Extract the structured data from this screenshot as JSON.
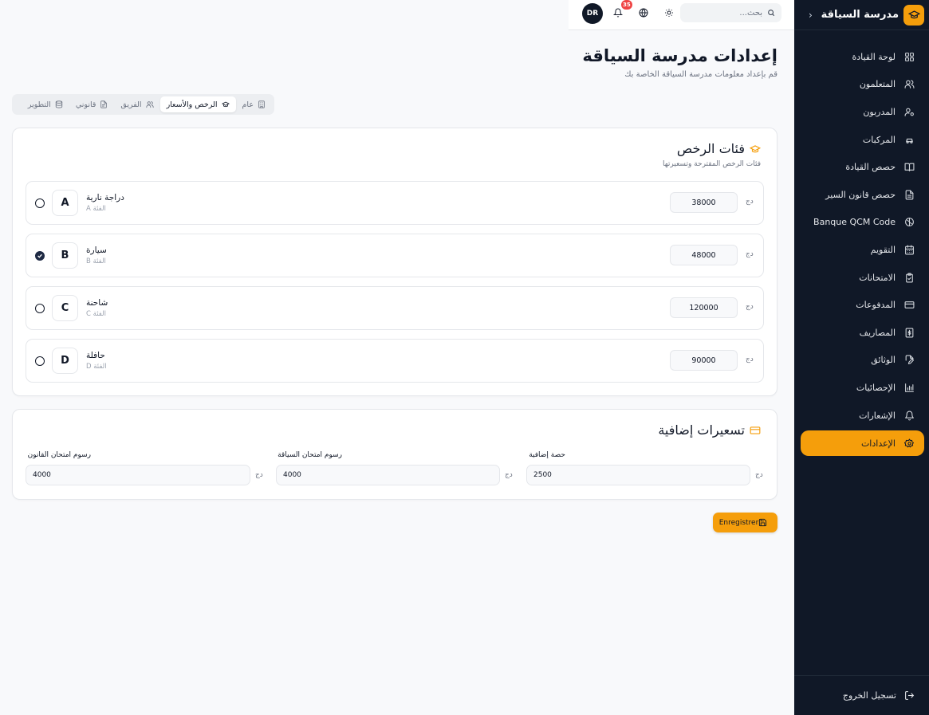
{
  "sidebar": {
    "brand": "مدرسة السياقة",
    "collapse_glyph": "‹",
    "items": [
      {
        "label": "لوحة القيادة",
        "icon": "grid-icon"
      },
      {
        "label": "المتعلمون",
        "icon": "users-icon"
      },
      {
        "label": "المدربون",
        "icon": "user-cog-icon"
      },
      {
        "label": "المركبات",
        "icon": "car-icon"
      },
      {
        "label": "حصص القيادة",
        "icon": "book-open-icon"
      },
      {
        "label": "حصص قانون السير",
        "icon": "file-text-icon"
      },
      {
        "label": "Banque QCM Code",
        "icon": "brain-icon"
      },
      {
        "label": "التقويم",
        "icon": "calendar-icon"
      },
      {
        "label": "الامتحانات",
        "icon": "clipboard-check-icon"
      },
      {
        "label": "المدفوعات",
        "icon": "credit-card-icon"
      },
      {
        "label": "المصاريف",
        "icon": "receipt-icon"
      },
      {
        "label": "الوثائق",
        "icon": "file-edit-icon"
      },
      {
        "label": "الإحصائيات",
        "icon": "bar-chart-icon"
      },
      {
        "label": "الإشعارات",
        "icon": "bell-icon"
      },
      {
        "label": "الإعدادات",
        "icon": "settings-icon",
        "active": true
      }
    ],
    "logout": "تسجيل الخروج"
  },
  "topbar": {
    "search_placeholder": "بحث...",
    "notif_count": "35",
    "avatar": "DR"
  },
  "header": {
    "title": "إعدادات مدرسة السياقة",
    "subtitle": "قم بإعداد معلومات مدرسة السياقة الخاصة بك"
  },
  "tabs": [
    {
      "label": "عام",
      "icon": "building-icon"
    },
    {
      "label": "الرخص والأسعار",
      "icon": "graduation-cap-icon",
      "active": true
    },
    {
      "label": "الفريق",
      "icon": "users-icon"
    },
    {
      "label": "قانوني",
      "icon": "file-icon"
    },
    {
      "label": "التطوير",
      "icon": "database-icon"
    }
  ],
  "licenses": {
    "title": "فئات الرخص",
    "subtitle": "فئات الرخص المقترحة وتسعيرتها",
    "currency": "دج",
    "items": [
      {
        "letter": "A",
        "name": "دراجة نارية",
        "category": "الفئة A",
        "price": "38000",
        "selected": false
      },
      {
        "letter": "B",
        "name": "سيارة",
        "category": "الفئة B",
        "price": "48000",
        "selected": true
      },
      {
        "letter": "C",
        "name": "شاحنة",
        "category": "الفئة C",
        "price": "120000",
        "selected": false
      },
      {
        "letter": "D",
        "name": "حافلة",
        "category": "الفئة D",
        "price": "90000",
        "selected": false
      }
    ]
  },
  "extra": {
    "title": "تسعيرات إضافية",
    "currency": "دج",
    "fields": [
      {
        "label": "حصة إضافية",
        "value": "2500"
      },
      {
        "label": "رسوم امتحان السياقة",
        "value": "4000"
      },
      {
        "label": "رسوم امتحان القانون",
        "value": "4000"
      }
    ]
  },
  "save_label": "Enregistrer",
  "colors": {
    "accent": "#f59e0b",
    "sidebar_bg": "#101827",
    "badge": "#ef4444"
  }
}
